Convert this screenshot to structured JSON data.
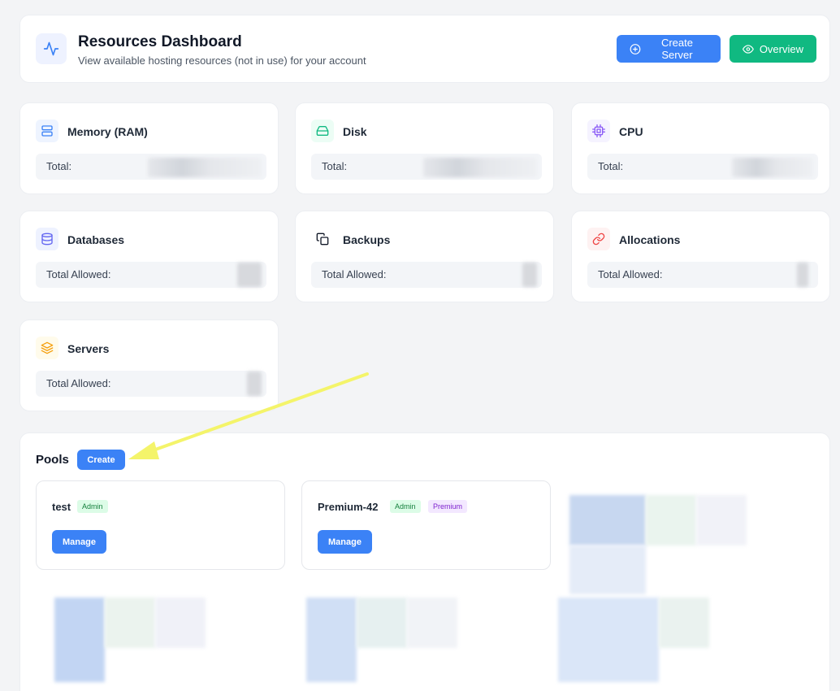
{
  "header": {
    "icon": "activity-icon",
    "title": "Resources Dashboard",
    "subtitle": "View available hosting resources (not in use) for your account",
    "create_server_label": "Create Server",
    "overview_label": "Overview"
  },
  "resources": [
    {
      "name": "Memory (RAM)",
      "label": "Total:",
      "icon": "server-icon",
      "color": "#3b82f6"
    },
    {
      "name": "Disk",
      "label": "Total:",
      "icon": "hard-drive-icon",
      "color": "#10b981"
    },
    {
      "name": "CPU",
      "label": "Total:",
      "icon": "cpu-icon",
      "color": "#8b5cf6"
    },
    {
      "name": "Databases",
      "label": "Total Allowed:",
      "icon": "database-icon",
      "color": "#6366f1"
    },
    {
      "name": "Backups",
      "label": "Total Allowed:",
      "icon": "copy-icon",
      "color": "#111827"
    },
    {
      "name": "Allocations",
      "label": "Total Allowed:",
      "icon": "link-icon",
      "color": "#ef4444"
    },
    {
      "name": "Servers",
      "label": "Total Allowed:",
      "icon": "layers-icon",
      "color": "#f59e0b"
    }
  ],
  "pools": {
    "title": "Pools",
    "create_label": "Create",
    "items": [
      {
        "name": "test",
        "badges": [
          "Admin"
        ],
        "manage_label": "Manage"
      },
      {
        "name": "Premium-42",
        "badges": [
          "Admin",
          "Premium"
        ],
        "manage_label": "Manage"
      }
    ]
  }
}
